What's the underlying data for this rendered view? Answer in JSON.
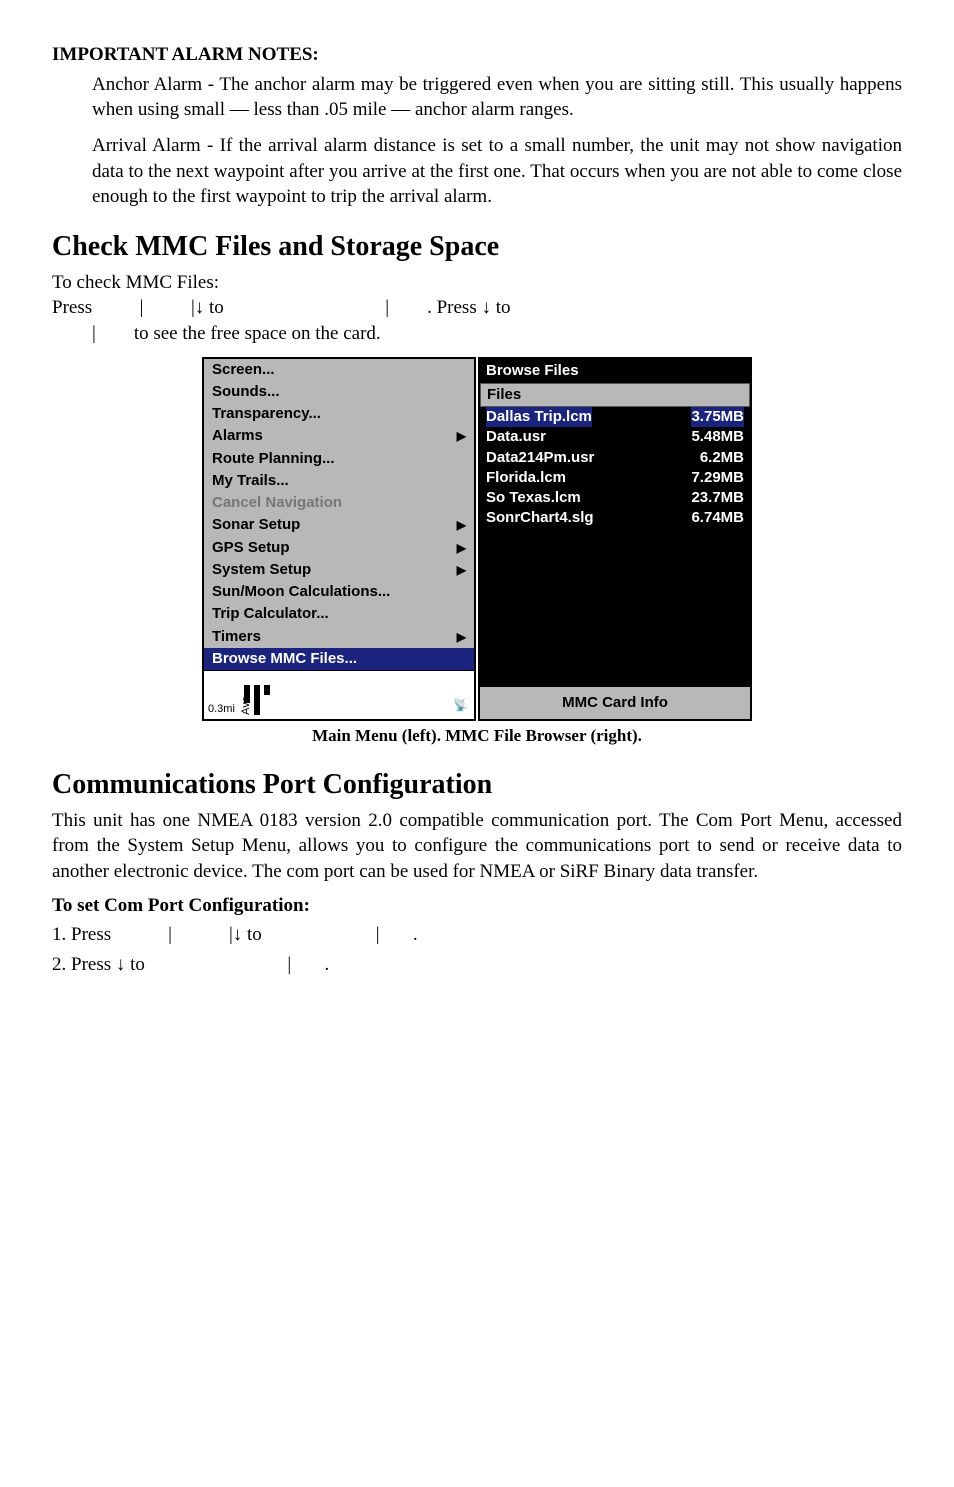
{
  "sec1": {
    "heading": "IMPORTANT ALARM NOTES:",
    "para1": "Anchor Alarm - The anchor alarm may be triggered even when you are sitting still. This usually happens when using small — less than .05 mile — anchor alarm ranges.",
    "para2": "Arrival Alarm - If the arrival alarm distance is set to a small number, the unit may not show navigation data to the next waypoint after you arrive at the first one. That occurs when you are not able to come close enough to the first waypoint to trip the arrival alarm."
  },
  "sec2": {
    "heading": "Check MMC Files and Storage Space",
    "sub": "To check MMC Files:",
    "line1_a": "Press ",
    "line1_b": "|",
    "line1_c": "|↓ to ",
    "line1_d": "|",
    "line1_e": ". Press ↓ to ",
    "line2_a": "|",
    "line2_b": " to see the free space on the card."
  },
  "menu": {
    "items": [
      {
        "label": "Screen...",
        "arrow": false
      },
      {
        "label": "Sounds...",
        "arrow": false
      },
      {
        "label": "Transparency...",
        "arrow": false
      },
      {
        "label": "Alarms",
        "arrow": true
      },
      {
        "label": "Route Planning...",
        "arrow": false
      },
      {
        "label": "My Trails...",
        "arrow": false
      },
      {
        "label": "Cancel Navigation",
        "arrow": false,
        "disabled": true
      },
      {
        "label": "Sonar Setup",
        "arrow": true
      },
      {
        "label": "GPS Setup",
        "arrow": true
      },
      {
        "label": "System Setup",
        "arrow": true
      },
      {
        "label": "Sun/Moon Calculations...",
        "arrow": false
      },
      {
        "label": "Trip Calculator...",
        "arrow": false
      },
      {
        "label": "Timers",
        "arrow": true
      },
      {
        "label": "Browse MMC Files...",
        "arrow": false,
        "selected": true
      }
    ],
    "bottom_left": "0.3mi",
    "bottom_ave": "Ave",
    "bottom_sat": "📡"
  },
  "browser": {
    "title": "Browse Files",
    "header": "Files",
    "files": [
      {
        "name": "Dallas Trip.lcm",
        "size": "3.75MB",
        "selected": true
      },
      {
        "name": "Data.usr",
        "size": "5.48MB"
      },
      {
        "name": "Data214Pm.usr",
        "size": "6.2MB"
      },
      {
        "name": "Florida.lcm",
        "size": "7.29MB"
      },
      {
        "name": "So Texas.lcm",
        "size": "23.7MB"
      },
      {
        "name": "SonrChart4.slg",
        "size": "6.74MB"
      }
    ],
    "cardinfo": "MMC Card Info"
  },
  "caption": "Main Menu (left). MMC File Browser (right).",
  "sec3": {
    "heading": "Communications Port Configuration",
    "para": "This unit has one NMEA 0183 version 2.0 compatible communication port. The Com Port Menu, accessed from the System Setup Menu, allows you to configure the communications port to send or receive data to another electronic device. The com port can be used for NMEA or SiRF Binary data transfer.",
    "sub": "To set Com Port Configuration:",
    "step1_a": "1. Press ",
    "step1_b": "|",
    "step1_c": "|↓ to ",
    "step1_d": "|",
    "step1_e": ".",
    "step2_a": "2. Press ↓ to ",
    "step2_b": "|",
    "step2_c": "."
  }
}
